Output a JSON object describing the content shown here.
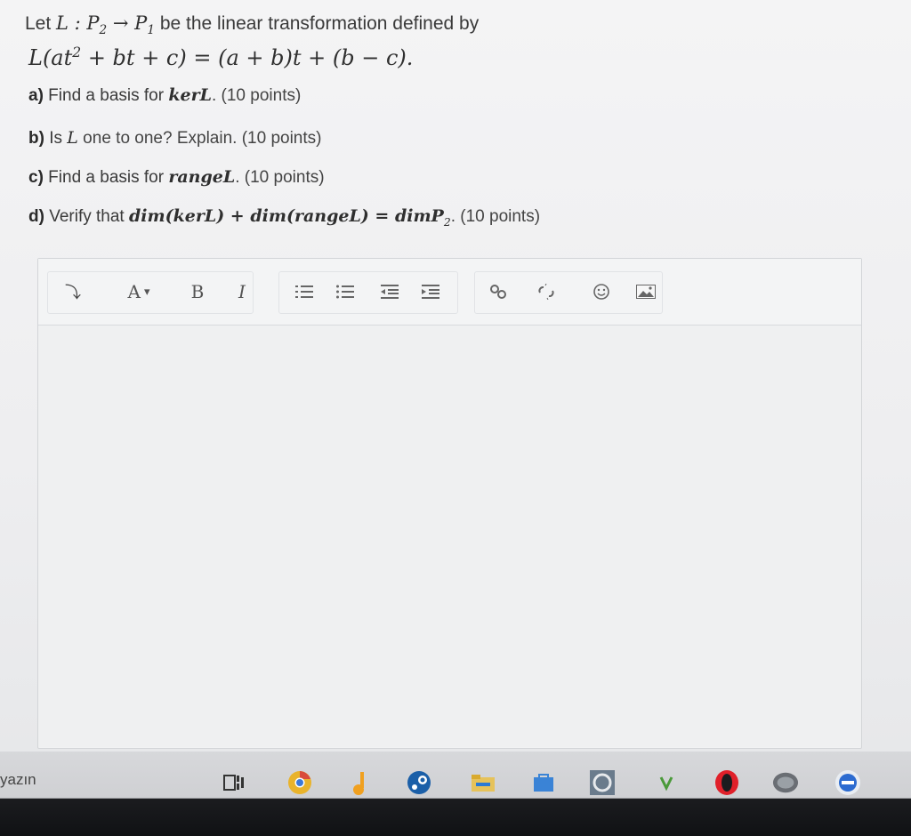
{
  "question": {
    "intro_before": "Let ",
    "intro_math": "L : P",
    "intro_sub2": "2",
    "intro_arrow": " → P",
    "intro_sub1": "1",
    "intro_after": " be the linear transformation defined by",
    "def_lhs": "L(at",
    "def_sup": "2",
    "def_rest": " + bt + c) = (a + b)t + (b − c).",
    "a_label": "a)",
    "a_text": " Find a basis for ",
    "a_math": "kerL",
    "a_points": ". (10 points)",
    "b_label": "b)",
    "b_text1": " Is ",
    "b_math": "L",
    "b_text2": " one to one? Explain. (10 points)",
    "c_label": "c)",
    "c_text": " Find a basis for ",
    "c_math": "rangeL",
    "c_points": ". (10 points)",
    "d_label": "d)",
    "d_text": " Verify that ",
    "d_math": "dim(kerL) + dim(rangeL) = dimP",
    "d_sub": "2",
    "d_points": ". (10 points)"
  },
  "toolbar": {
    "paragraph_glyph": "⤵",
    "font_glyph": "A",
    "font_caret": "▾",
    "bold": "B",
    "italic": "I"
  },
  "taskbar": {
    "search_label": "yazın"
  },
  "icons": {
    "paragraph": "paragraph-format-icon",
    "font": "font-color-icon",
    "ordered_list": "ordered-list-icon",
    "unordered_list": "unordered-list-icon",
    "outdent": "outdent-icon",
    "indent": "indent-icon",
    "link": "link-icon",
    "unlink": "unlink-icon",
    "emoji": "emoji-icon",
    "image": "image-icon"
  },
  "colors": {
    "opera_red": "#e0202a",
    "chrome_orange": "#f0a020",
    "steam_blue": "#1b5fa8"
  }
}
